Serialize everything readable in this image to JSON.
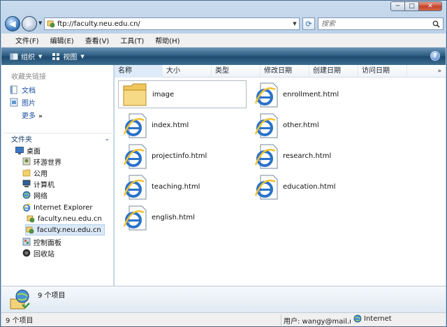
{
  "window": {
    "caption_buttons": {
      "minimize": "─",
      "maximize": "□",
      "close": "✕"
    }
  },
  "address_bar": {
    "url": "ftp://faculty.neu.edu.cn/",
    "search_placeholder": "搜索"
  },
  "menu": [
    "文件(F)",
    "编辑(E)",
    "查看(V)",
    "工具(T)",
    "帮助(H)"
  ],
  "command_bar": {
    "organize": "组织",
    "views": "视图",
    "help": "?"
  },
  "nav_pane": {
    "favorites_header": "收藏夹链接",
    "favorites": [
      "文档",
      "图片"
    ],
    "more": "更多",
    "folders_header": "文件夹",
    "tree": [
      {
        "label": "桌面",
        "icon": "desktop-icon"
      },
      {
        "label": "环游世界",
        "icon": "user-folder-icon"
      },
      {
        "label": "公用",
        "icon": "folder-icon"
      },
      {
        "label": "计算机",
        "icon": "computer-icon"
      },
      {
        "label": "网络",
        "icon": "network-icon"
      },
      {
        "label": "Internet Explorer",
        "icon": "ie-icon"
      },
      {
        "label": "faculty.neu.edu.cn",
        "icon": "ftp-site-icon"
      },
      {
        "label": "faculty.neu.edu.cn",
        "icon": "ftp-site-icon",
        "selected": true
      },
      {
        "label": "控制面板",
        "icon": "control-panel-icon"
      },
      {
        "label": "回收站",
        "icon": "recycle-bin-icon"
      }
    ]
  },
  "columns": [
    "名称",
    "大小",
    "类型",
    "修改日期",
    "创建日期",
    "访问日期"
  ],
  "files": [
    {
      "name": "image",
      "type": "folder"
    },
    {
      "name": "enrollment.html",
      "type": "html"
    },
    {
      "name": "index.html",
      "type": "html"
    },
    {
      "name": "other.html",
      "type": "html"
    },
    {
      "name": "projectinfo.html",
      "type": "html"
    },
    {
      "name": "research.html",
      "type": "html"
    },
    {
      "name": "teaching.html",
      "type": "html"
    },
    {
      "name": "education.html",
      "type": "html"
    },
    {
      "name": "english.html",
      "type": "html"
    }
  ],
  "details": {
    "item_count": "9 个项目"
  },
  "status_bar": {
    "items": "9 个项目",
    "user": "用户: wangy@mail.ne",
    "zone": "Internet"
  }
}
